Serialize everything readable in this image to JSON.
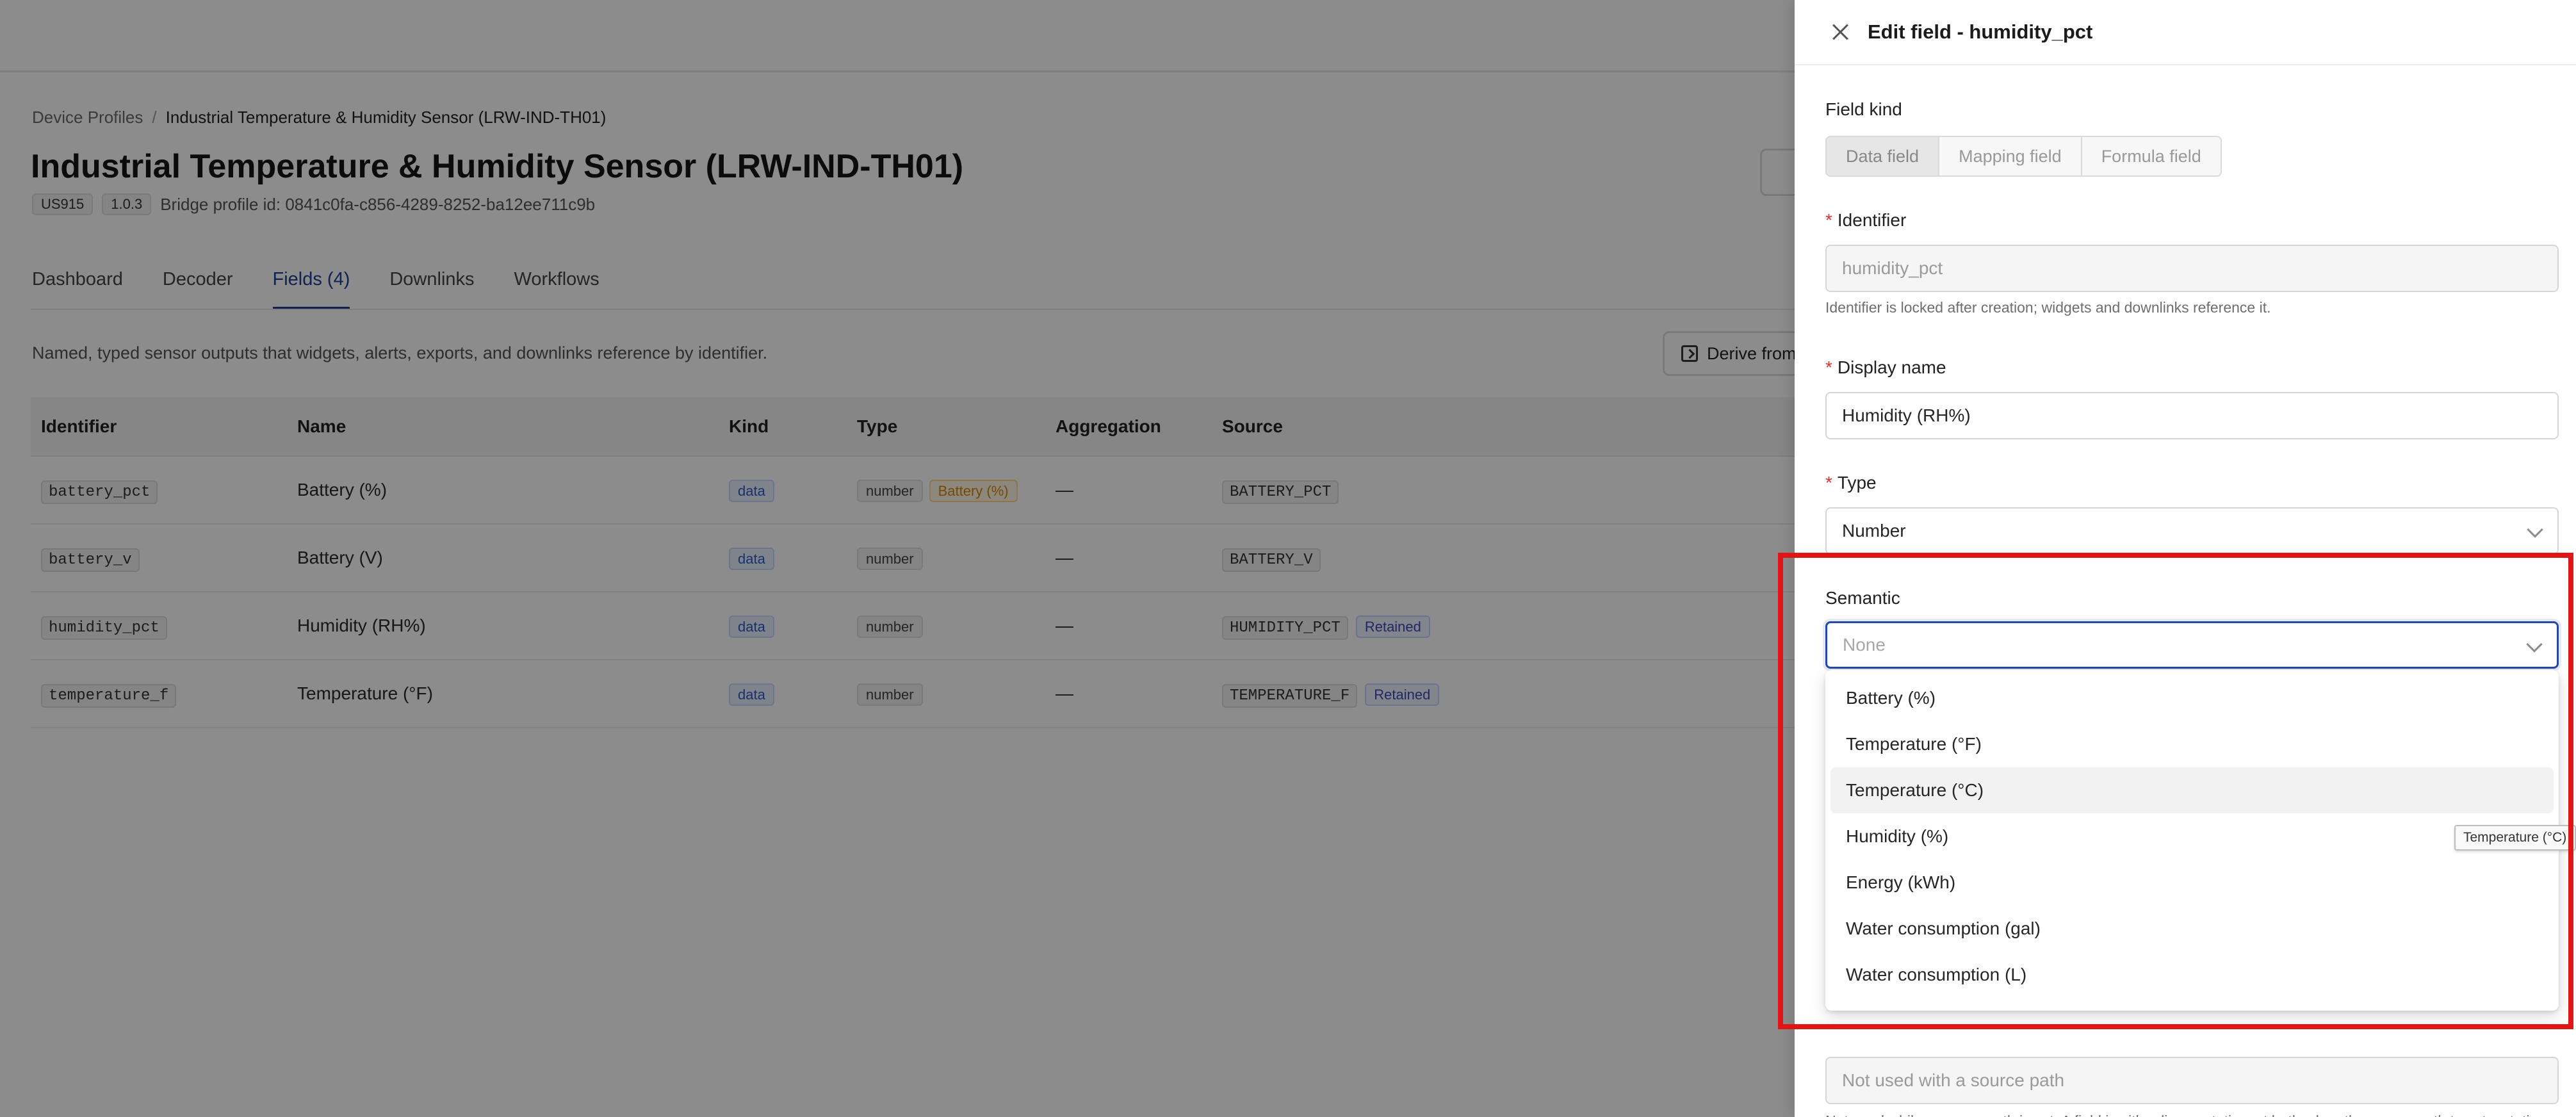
{
  "breadcrumb": {
    "root": "Device Profiles",
    "separator": "/",
    "current": "Industrial Temperature & Humidity Sensor (LRW-IND-TH01)"
  },
  "page": {
    "title": "Industrial Temperature & Humidity Sensor (LRW-IND-TH01)",
    "region_chip": "US915",
    "version_chip": "1.0.3",
    "bridge_profile": "Bridge profile id: 0841c0fa-c856-4289-8252-ba12ee711c9b"
  },
  "tabs": [
    {
      "label": "Dashboard",
      "active": false
    },
    {
      "label": "Decoder",
      "active": false
    },
    {
      "label": "Fields (4)",
      "active": true
    },
    {
      "label": "Downlinks",
      "active": false
    },
    {
      "label": "Workflows",
      "active": false
    }
  ],
  "fields_section": {
    "description": "Named, typed sensor outputs that widgets, alerts, exports, and downlinks reference by identifier.",
    "derive_button": "Derive from",
    "columns": [
      "Identifier",
      "Name",
      "Kind",
      "Type",
      "Aggregation",
      "Source"
    ],
    "rows": [
      {
        "identifier": "battery_pct",
        "name": "Battery (%)",
        "kind": "data",
        "type": "number",
        "semantic": "Battery (%)",
        "aggregation": "—",
        "source": "BATTERY_PCT",
        "retained": ""
      },
      {
        "identifier": "battery_v",
        "name": "Battery (V)",
        "kind": "data",
        "type": "number",
        "semantic": "",
        "aggregation": "—",
        "source": "BATTERY_V",
        "retained": ""
      },
      {
        "identifier": "humidity_pct",
        "name": "Humidity (RH%)",
        "kind": "data",
        "type": "number",
        "semantic": "",
        "aggregation": "—",
        "source": "HUMIDITY_PCT",
        "retained": "Retained"
      },
      {
        "identifier": "temperature_f",
        "name": "Temperature (°F)",
        "kind": "data",
        "type": "number",
        "semantic": "",
        "aggregation": "—",
        "source": "TEMPERATURE_F",
        "retained": "Retained"
      }
    ]
  },
  "drawer": {
    "title": "Edit field - humidity_pct",
    "field_kind_label": "Field kind",
    "field_kind_options": [
      "Data field",
      "Mapping field",
      "Formula field"
    ],
    "field_kind_selected": "Data field",
    "identifier_label": "Identifier",
    "identifier_value": "humidity_pct",
    "identifier_help": "Identifier is locked after creation; widgets and downlinks reference it.",
    "display_name_label": "Display name",
    "display_name_value": "Humidity (RH%)",
    "type_label": "Type",
    "type_value": "Number",
    "semantic_label": "Semantic",
    "semantic_placeholder": "None",
    "static_placeholder": "Not used with a source path",
    "static_help": "Not used while a source path is set. A field is either live or static, not both; clear the source path to set a static default."
  },
  "semantic_options": [
    "Battery (%)",
    "Temperature (°F)",
    "Temperature (°C)",
    "Humidity (%)",
    "Energy (kWh)",
    "Water consumption (gal)",
    "Water consumption (L)"
  ],
  "hovered_option": "Temperature (°C)",
  "tooltip": "Temperature (°C)",
  "colors": {
    "accent": "#1d3f99",
    "focus": "#2548a8",
    "highlight": "#e01616",
    "required": "#e03131"
  }
}
